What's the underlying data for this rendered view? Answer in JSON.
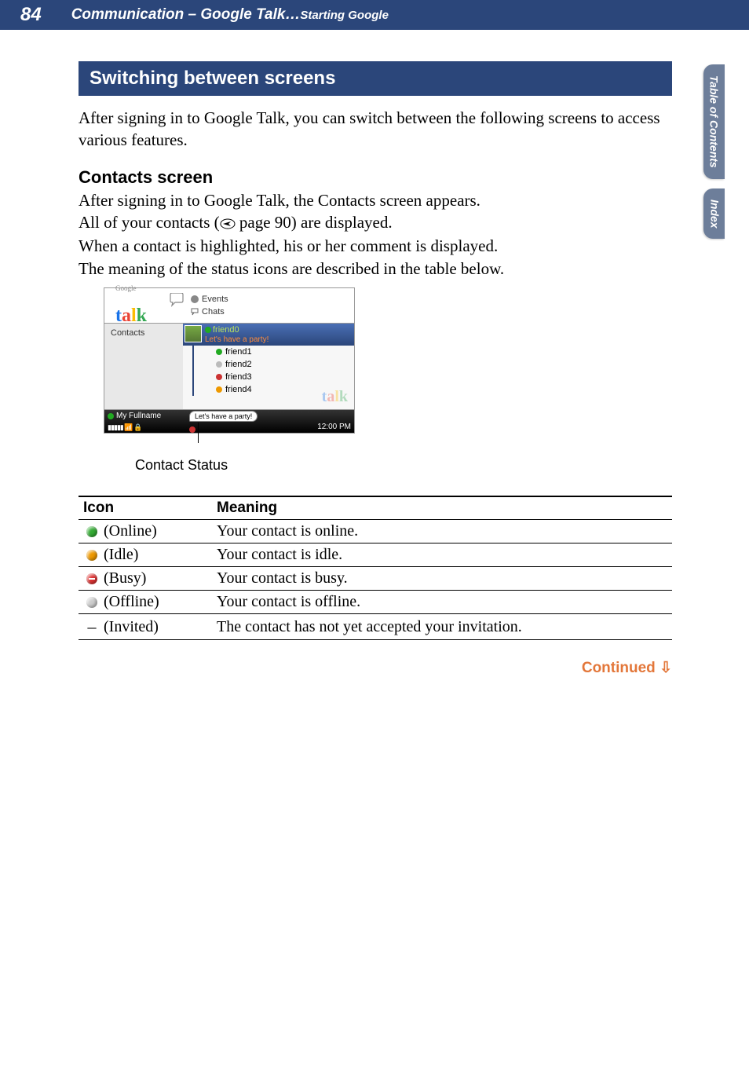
{
  "header": {
    "page_number": "84",
    "breadcrumb_main": "Communication – Google Talk…",
    "breadcrumb_sub": "Starting Google"
  },
  "section_heading": "Switching between screens",
  "intro_text": "After signing in to Google Talk, you can switch between the following screens to access various features.",
  "contacts": {
    "heading": "Contacts screen",
    "line1": "After signing in to Google Talk, the Contacts screen appears.",
    "line2a": "All of your contacts (",
    "line2b": " page 90) are displayed.",
    "line3": "When a contact is highlighted, his or her comment is displayed.",
    "line4": "The meaning of the status icons are described in the table below."
  },
  "screenshot": {
    "events": "Events",
    "chats": "Chats",
    "contacts_label": "Contacts",
    "selected_name": "friend0",
    "selected_msg": "Let's have a party!",
    "friends": [
      "friend1",
      "friend2",
      "friend3",
      "friend4"
    ],
    "status_name": "My Fullname",
    "status_bubble": "Let's have a party!",
    "time": "12:00 PM",
    "caption": "Contact Status"
  },
  "table": {
    "header_icon": "Icon",
    "header_meaning": "Meaning",
    "rows": [
      {
        "label": "(Online)",
        "meaning": "Your contact is online."
      },
      {
        "label": "(Idle)",
        "meaning": "Your contact is idle."
      },
      {
        "label": "(Busy)",
        "meaning": "Your contact is busy."
      },
      {
        "label": "(Offline)",
        "meaning": "Your contact is offline."
      },
      {
        "label": "(Invited)",
        "meaning": "The contact has not yet accepted your invitation."
      }
    ],
    "invited_symbol": "–"
  },
  "continued": "Continued",
  "tabs": {
    "toc1": "Table of",
    "toc2": "Contents",
    "index": "Index"
  }
}
